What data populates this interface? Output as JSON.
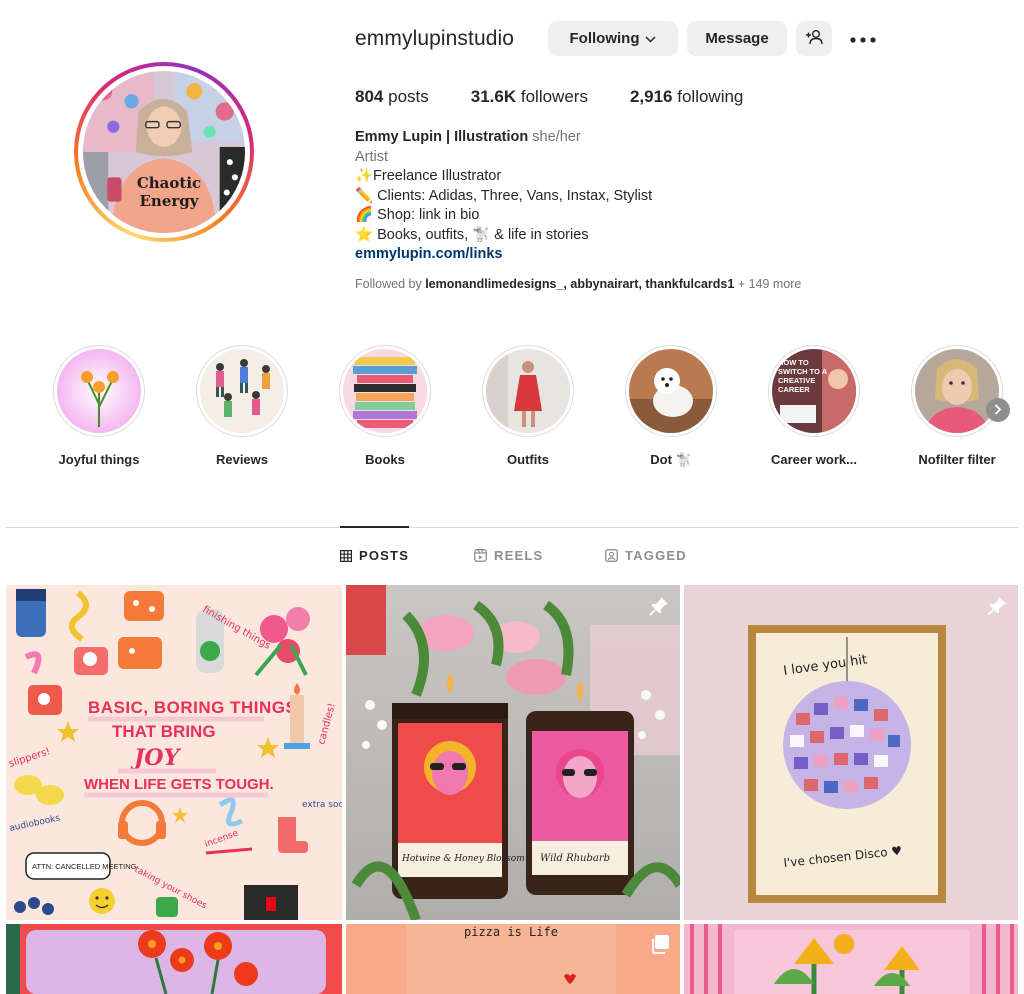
{
  "profile": {
    "username": "emmylupinstudio",
    "following_label": "Following",
    "message_label": "Message",
    "stats": {
      "posts_count": "804",
      "posts_label": "posts",
      "followers_count": "31.6K",
      "followers_label": "followers",
      "following_count": "2,916",
      "following_label": "following"
    },
    "bio": {
      "name": "Emmy Lupin | Illustration",
      "pronouns": "she/her",
      "category": "Artist",
      "line1": "✨Freelance Illustrator",
      "line2": "✏️ Clients: Adidas, Three, Vans, Instax, Stylist",
      "line3": "🌈 Shop: link in bio",
      "line4": "⭐ Books, outfits, 🐩 & life in stories",
      "link": "emmylupin.com/links"
    },
    "followed_by": {
      "prefix": "Followed by",
      "names": "lemonandlimedesigns_, abbynairart, thankfulcards1",
      "suffix": "+ 149 more"
    },
    "avatar_shirt_text_1": "Chaotic",
    "avatar_shirt_text_2": "Energy"
  },
  "highlights": [
    {
      "label": "Joyful things"
    },
    {
      "label": "Reviews"
    },
    {
      "label": "Books"
    },
    {
      "label": "Outfits"
    },
    {
      "label": "Dot 🐩"
    },
    {
      "label": "Career work..."
    },
    {
      "label": "Nofilter filter"
    }
  ],
  "highlight_career_text": "HOW TO SWITCH TO A CREATIVE CAREER",
  "tabs": [
    {
      "label": "POSTS",
      "active": true
    },
    {
      "label": "REELS",
      "active": false
    },
    {
      "label": "TAGGED",
      "active": false
    }
  ],
  "posts": {
    "p1": {
      "line1": "BASIC, BORING THINGS",
      "line2": "THAT BRING",
      "line3": "JOY",
      "line4": "WHEN LIFE GETS TOUGH.",
      "note_finishing": "finishing things",
      "note_candles": "candles!",
      "note_slippers": "slippers!",
      "note_audiobooks": "audiobooks",
      "note_cancelled": "ATTN: CANCELLED MEETING",
      "note_incense": "incense",
      "note_socks": "extra socks",
      "note_shoes": "taking your shoes"
    },
    "p2": {
      "label1": "Hotwine & Honey Blossom",
      "label2": "Wild Rhubarb"
    },
    "p3": {
      "text_top": "I love you hit",
      "text_bottom": "I've chosen Disco ♥"
    },
    "p5": {
      "text": "pizza is Life"
    }
  },
  "colors": {
    "ring_gradient": [
      "#feda75",
      "#fa7e1e",
      "#d62976",
      "#962fbf"
    ],
    "link": "#00376b",
    "muted": "#737373",
    "button_bg": "#efefef"
  }
}
